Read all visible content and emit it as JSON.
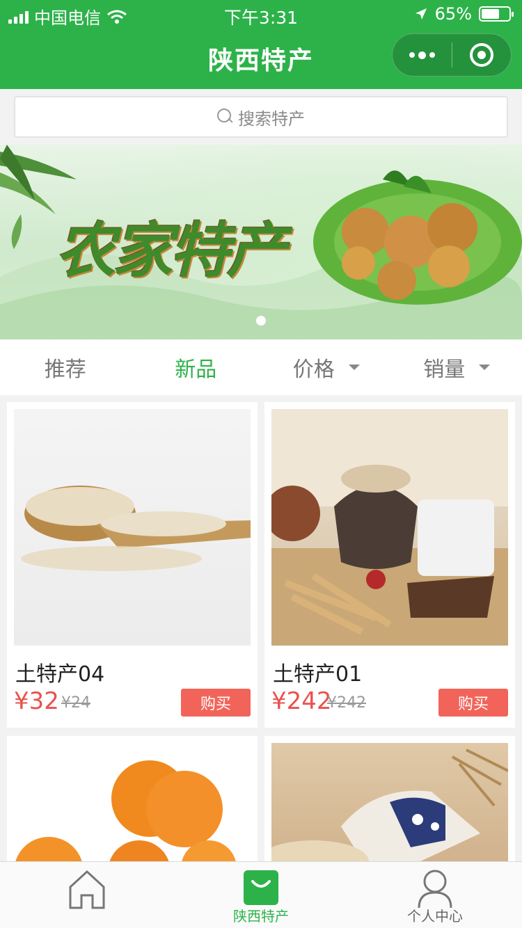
{
  "status_bar": {
    "carrier": "中国电信",
    "time": "下午3:31",
    "battery": "65%",
    "battery_level": 0.65
  },
  "nav": {
    "title": "陕西特产"
  },
  "search": {
    "placeholder": "搜索特产"
  },
  "banner": {
    "headline": "农家特产"
  },
  "filters": [
    {
      "label": "推荐",
      "active": false,
      "dropdown": false
    },
    {
      "label": "新品",
      "active": true,
      "dropdown": false
    },
    {
      "label": "价格",
      "active": false,
      "dropdown": true
    },
    {
      "label": "销量",
      "active": false,
      "dropdown": true
    }
  ],
  "products": [
    {
      "name": "土特产04",
      "price": "¥32",
      "original_price": "¥24",
      "buy_label": "购买"
    },
    {
      "name": "土特产01",
      "price": "¥242",
      "original_price": "¥242",
      "buy_label": "购买"
    },
    {
      "name": "",
      "price": "",
      "original_price": "",
      "buy_label": ""
    },
    {
      "name": "",
      "price": "",
      "original_price": "",
      "buy_label": ""
    }
  ],
  "tabbar": {
    "items": [
      {
        "label": "",
        "icon": "home-icon",
        "active": false
      },
      {
        "label": "陕西特产",
        "icon": "shopping-bag-icon",
        "active": true
      },
      {
        "label": "个人中心",
        "icon": "user-icon",
        "active": false
      }
    ]
  },
  "colors": {
    "brand_green": "#2db24a",
    "price_red": "#e9524c",
    "buy_button": "#f2645a"
  }
}
